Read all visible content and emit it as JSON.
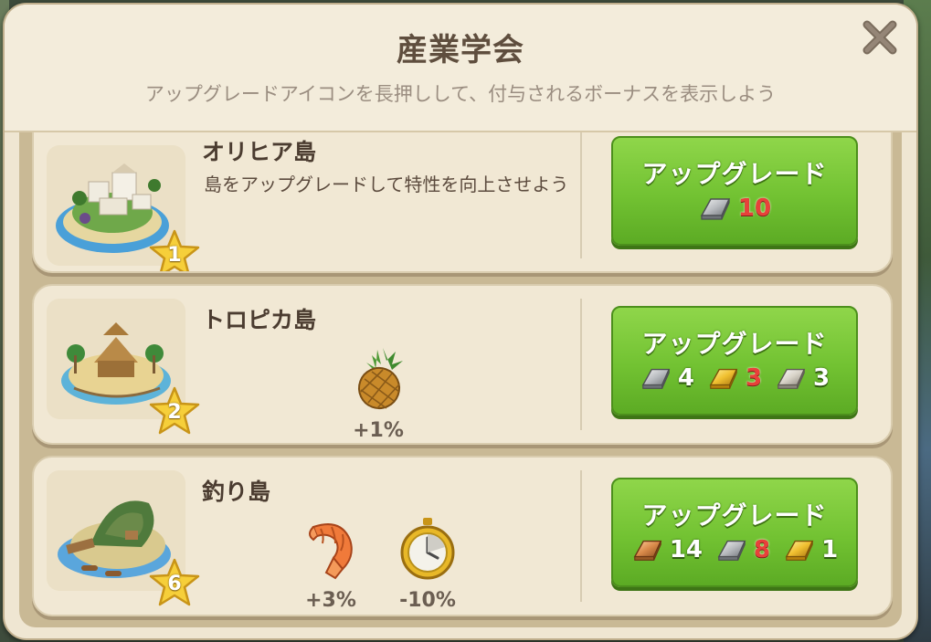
{
  "modal": {
    "title": "産業学会",
    "subtitle": "アップグレードアイコンを長押しして、付与されるボーナスを表示しよう",
    "close_icon": "close-icon"
  },
  "islands": [
    {
      "name": "オリヒア島",
      "level": "1",
      "description": "島をアップグレードして特性を向上させよう",
      "bonuses": [],
      "button_label": "アップグレード",
      "costs": [
        {
          "icon": "silver-bar-icon",
          "amount": "10",
          "insufficient": true
        }
      ]
    },
    {
      "name": "トロピカ島",
      "level": "2",
      "description": "",
      "bonuses": [
        {
          "icon": "pineapple-icon",
          "value": "+1%"
        }
      ],
      "button_label": "アップグレード",
      "costs": [
        {
          "icon": "silver-bar-icon",
          "amount": "4",
          "insufficient": false
        },
        {
          "icon": "gold-bar-icon",
          "amount": "3",
          "insufficient": true
        },
        {
          "icon": "platinum-bar-icon",
          "amount": "3",
          "insufficient": false
        }
      ]
    },
    {
      "name": "釣り島",
      "level": "6",
      "description": "",
      "bonuses": [
        {
          "icon": "shrimp-icon",
          "value": "+3%"
        },
        {
          "icon": "stopwatch-icon",
          "value": "-10%"
        }
      ],
      "button_label": "アップグレード",
      "costs": [
        {
          "icon": "copper-bar-icon",
          "amount": "14",
          "insufficient": false
        },
        {
          "icon": "silver-bar-icon",
          "amount": "8",
          "insufficient": true
        },
        {
          "icon": "gold-bar-icon",
          "amount": "1",
          "insufficient": false
        }
      ]
    }
  ],
  "colors": {
    "button_green": "#72c232",
    "insufficient_red": "#e8413a",
    "panel_bg": "#efe6d2"
  }
}
